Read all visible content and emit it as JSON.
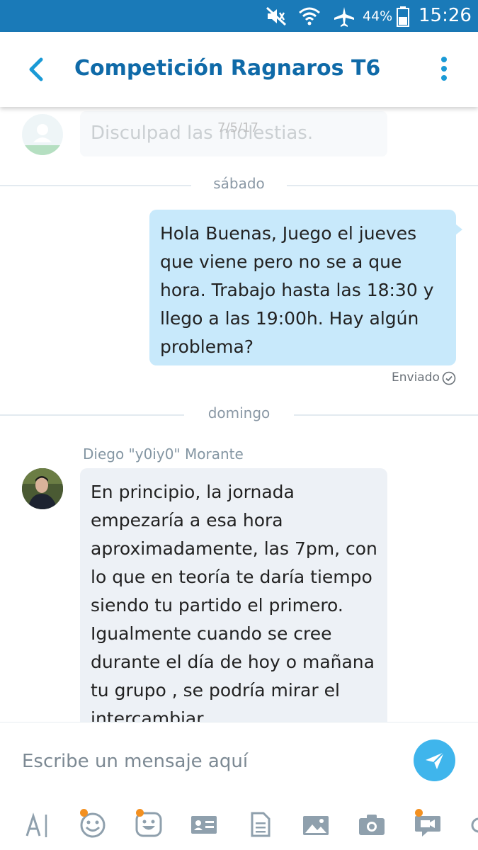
{
  "status_bar": {
    "battery": "44%",
    "time": "15:26",
    "icons": [
      "mute-icon",
      "wifi-icon",
      "airplane-icon",
      "battery-icon"
    ]
  },
  "header": {
    "title": "Competición Ragnaros T6",
    "back_icon": "chevron-left-icon",
    "menu_icon": "more-vertical-icon"
  },
  "chat": {
    "faded_message": {
      "date": "7/5/17",
      "text": "Disculpad las molestias."
    },
    "separators": [
      "sábado",
      "domingo"
    ],
    "outgoing": {
      "text": "Hola Buenas, Juego el jueves que viene pero no se a que hora. Trabajo hasta las 18:30 y llego a las 19:00h. Hay algún problema?",
      "status": "Enviado"
    },
    "incoming": {
      "sender": "Diego \"y0iy0\" Morante",
      "text": "En principio, la jornada empezaría a esa hora aproximadamente, las 7pm, con lo que en teoría te daría tiempo siendo tu partido el primero. Igualmente cuando se cree durante el día de hoy o mañana tu grupo , se podría mirar el intercambiar"
    }
  },
  "composer": {
    "placeholder": "Escribe un mensaje aquí",
    "tools": [
      "text-format-icon",
      "emoji-icon",
      "mojis-icon",
      "contact-card-icon",
      "file-icon",
      "photo-gallery-icon",
      "camera-icon",
      "video-message-icon"
    ]
  },
  "colors": {
    "status_bar": "#1a7ab8",
    "title": "#0f6aa8",
    "accent": "#3fb5ec",
    "outgoing_bubble": "#c8e9fb",
    "incoming_bubble": "#edf1f6",
    "badge": "#f39020"
  }
}
